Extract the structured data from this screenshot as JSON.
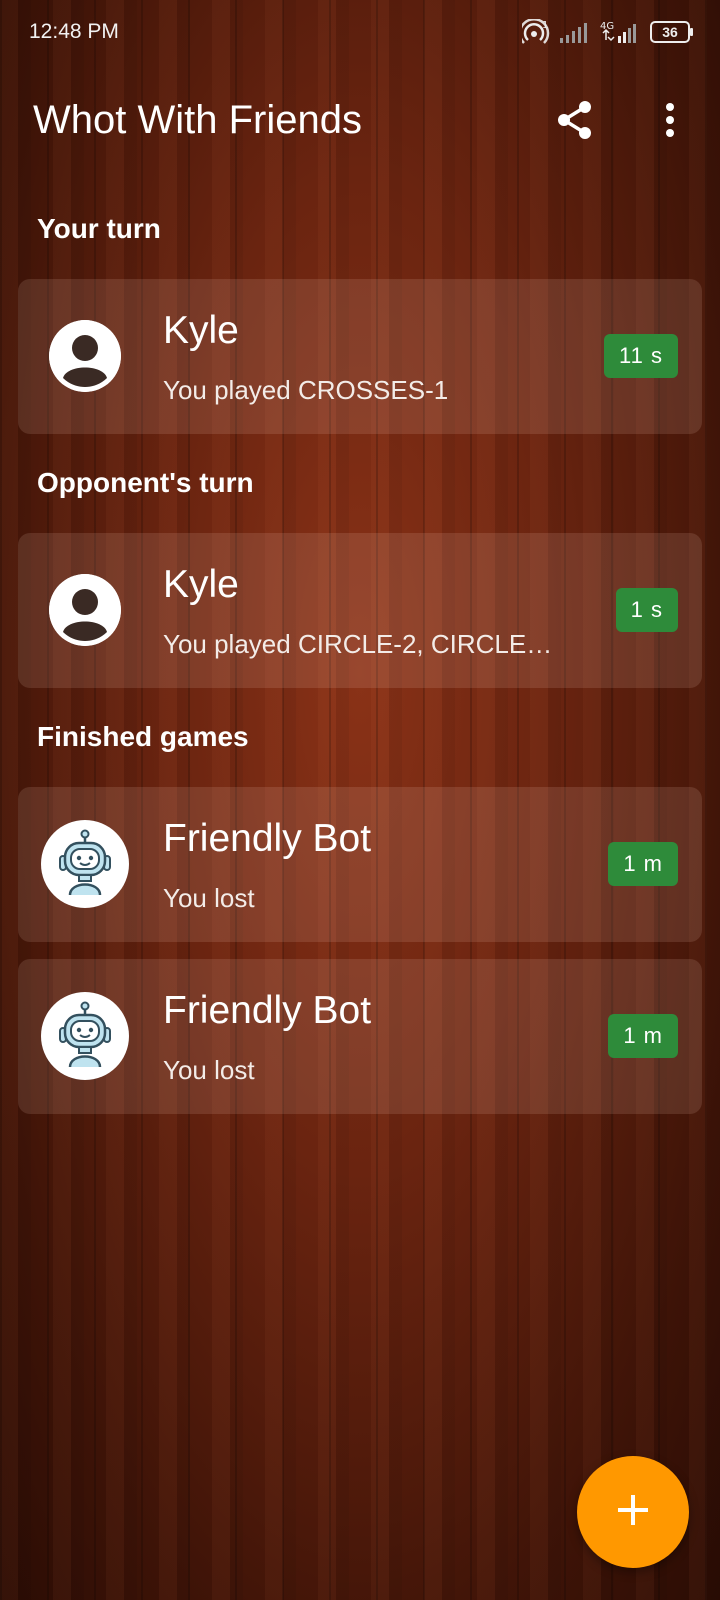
{
  "status_bar": {
    "time": "12:48 PM",
    "network": "4G",
    "hotspot_badge": "1",
    "battery": "36"
  },
  "app_bar": {
    "title": "Whot With Friends",
    "share_icon": "share-icon",
    "menu_icon": "more-vert-icon"
  },
  "sections": {
    "your_turn": {
      "title": "Your turn",
      "games": [
        {
          "name": "Kyle",
          "subtitle": "You played CROSSES-1",
          "time": "11 s",
          "avatar": "person-icon"
        }
      ]
    },
    "opponent_turn": {
      "title": "Opponent's turn",
      "games": [
        {
          "name": "Kyle",
          "subtitle": "You played CIRCLE-2, CIRCLE…",
          "time": "1 s",
          "avatar": "person-icon"
        }
      ]
    },
    "finished": {
      "title": "Finished games",
      "games": [
        {
          "name": "Friendly Bot",
          "subtitle": "You lost",
          "time": "1 m",
          "avatar": "robot-icon"
        },
        {
          "name": "Friendly Bot",
          "subtitle": "You lost",
          "time": "1 m",
          "avatar": "robot-icon"
        }
      ]
    }
  },
  "fab": {
    "icon": "plus-icon"
  },
  "colors": {
    "badge": "#2e8b3a",
    "fab": "#ff9800",
    "background": "#6a2410"
  }
}
